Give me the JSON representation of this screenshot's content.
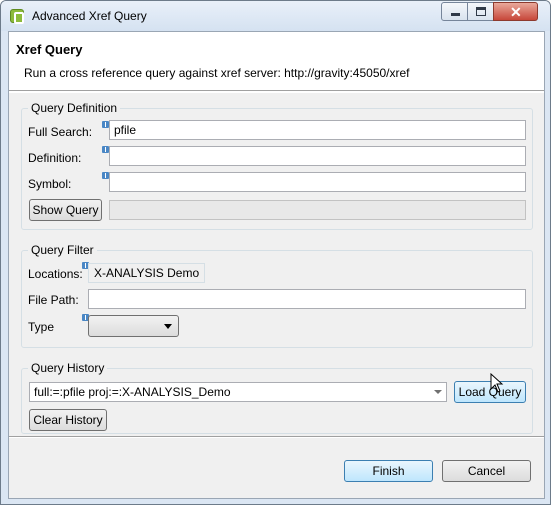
{
  "window": {
    "title": "Advanced Xref Query"
  },
  "banner": {
    "title": "Xref Query",
    "message": "Run a cross reference query against xref server: http://gravity:45050/xref"
  },
  "definition": {
    "group_title": "Query Definition",
    "full_search_label": "Full Search:",
    "full_search_value": "pfile",
    "definition_label": "Definition:",
    "definition_value": "",
    "symbol_label": "Symbol:",
    "symbol_value": "",
    "show_query_label": "Show Query",
    "query_preview_value": ""
  },
  "filter": {
    "group_title": "Query Filter",
    "locations_label": "Locations:",
    "locations_value": "X-ANALYSIS Demo",
    "file_path_label": "File Path:",
    "file_path_value": "",
    "type_label": "Type",
    "type_value": ""
  },
  "history": {
    "group_title": "Query History",
    "selected_query": "full:=:pfile  proj:=:X-ANALYSIS_Demo",
    "load_query_label": "Load Query",
    "clear_history_label": "Clear History"
  },
  "footer": {
    "finish_label": "Finish",
    "cancel_label": "Cancel"
  }
}
